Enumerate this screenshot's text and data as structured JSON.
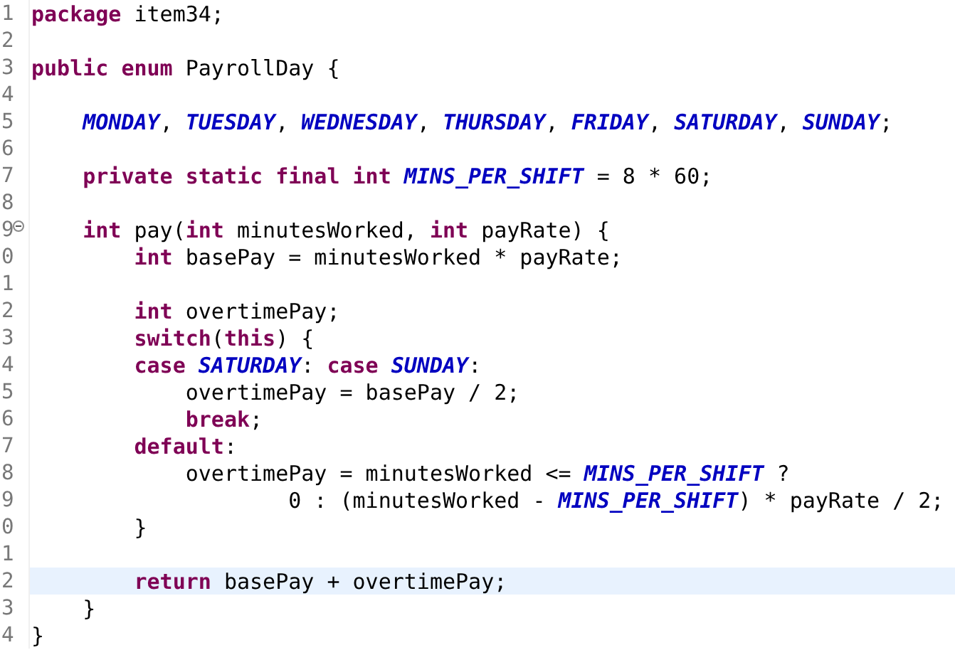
{
  "editor": {
    "lines": [
      {
        "number": "1",
        "current": false,
        "tokens": [
          {
            "kind": "keyword",
            "text": "package"
          },
          {
            "kind": "plain",
            "text": " item34;"
          }
        ]
      },
      {
        "number": "2",
        "current": false
      },
      {
        "number": "3",
        "current": false,
        "tokens": [
          {
            "kind": "keyword",
            "text": "public enum"
          },
          {
            "kind": "plain",
            "text": " PayrollDay {"
          }
        ]
      },
      {
        "number": "4",
        "current": false
      },
      {
        "number": "5",
        "current": false,
        "tokens": [
          {
            "kind": "constant",
            "text": "    MONDAY"
          },
          {
            "kind": "plain",
            "text": ", "
          },
          {
            "kind": "constant",
            "text": "TUESDAY"
          },
          {
            "kind": "plain",
            "text": ", "
          },
          {
            "kind": "constant",
            "text": "WEDNESDAY"
          },
          {
            "kind": "plain",
            "text": ", "
          },
          {
            "kind": "constant",
            "text": "THURSDAY"
          },
          {
            "kind": "plain",
            "text": ", "
          },
          {
            "kind": "constant",
            "text": "FRIDAY"
          },
          {
            "kind": "plain",
            "text": ", "
          },
          {
            "kind": "constant",
            "text": "SATURDAY"
          },
          {
            "kind": "plain",
            "text": ", "
          },
          {
            "kind": "constant",
            "text": "SUNDAY"
          },
          {
            "kind": "plain",
            "text": ";"
          }
        ]
      },
      {
        "number": "6",
        "current": false
      },
      {
        "number": "7",
        "current": false,
        "tokens": [
          {
            "kind": "keyword",
            "text": "    private static final int "
          },
          {
            "kind": "constant",
            "text": "MINS_PER_SHIFT"
          },
          {
            "kind": "plain",
            "text": " = 8 * 60;"
          }
        ]
      },
      {
        "number": "8",
        "current": false
      },
      {
        "number": "9",
        "current": false,
        "fold": {
          "expanded": true
        },
        "tokens": [
          {
            "kind": "keyword",
            "text": "    int"
          },
          {
            "kind": "plain",
            "text": " pay("
          },
          {
            "kind": "keyword",
            "text": "int"
          },
          {
            "kind": "plain",
            "text": " minutesWorked, "
          },
          {
            "kind": "keyword",
            "text": "int"
          },
          {
            "kind": "plain",
            "text": " payRate) {"
          }
        ]
      },
      {
        "number": "0",
        "current": false,
        "tokens": [
          {
            "kind": "keyword",
            "text": "        int"
          },
          {
            "kind": "plain",
            "text": " basePay = minutesWorked * payRate;"
          }
        ]
      },
      {
        "number": "1",
        "current": false
      },
      {
        "number": "2",
        "current": false,
        "tokens": [
          {
            "kind": "keyword",
            "text": "        int"
          },
          {
            "kind": "plain",
            "text": " overtimePay;"
          }
        ]
      },
      {
        "number": "3",
        "current": false,
        "tokens": [
          {
            "kind": "keyword",
            "text": "        switch"
          },
          {
            "kind": "plain",
            "text": "("
          },
          {
            "kind": "keyword",
            "text": "this"
          },
          {
            "kind": "plain",
            "text": ") {"
          }
        ]
      },
      {
        "number": "4",
        "current": false,
        "tokens": [
          {
            "kind": "keyword",
            "text": "        case "
          },
          {
            "kind": "constant",
            "text": "SATURDAY"
          },
          {
            "kind": "plain",
            "text": ": "
          },
          {
            "kind": "keyword",
            "text": "case "
          },
          {
            "kind": "constant",
            "text": "SUNDAY"
          },
          {
            "kind": "plain",
            "text": ":"
          }
        ]
      },
      {
        "number": "5",
        "current": false,
        "tokens": [
          {
            "kind": "plain",
            "text": "            overtimePay = basePay / 2;"
          }
        ]
      },
      {
        "number": "6",
        "current": false,
        "tokens": [
          {
            "kind": "keyword",
            "text": "            break"
          },
          {
            "kind": "plain",
            "text": ";"
          }
        ]
      },
      {
        "number": "7",
        "current": false,
        "tokens": [
          {
            "kind": "keyword",
            "text": "        default"
          },
          {
            "kind": "plain",
            "text": ":"
          }
        ]
      },
      {
        "number": "8",
        "current": false,
        "tokens": [
          {
            "kind": "plain",
            "text": "            overtimePay = minutesWorked <= "
          },
          {
            "kind": "constant",
            "text": "MINS_PER_SHIFT"
          },
          {
            "kind": "plain",
            "text": " ?"
          }
        ]
      },
      {
        "number": "9",
        "current": false,
        "tokens": [
          {
            "kind": "plain",
            "text": "                    0 : (minutesWorked - "
          },
          {
            "kind": "constant",
            "text": "MINS_PER_SHIFT"
          },
          {
            "kind": "plain",
            "text": ") * payRate / 2;"
          }
        ]
      },
      {
        "number": "0",
        "current": false,
        "tokens": [
          {
            "kind": "plain",
            "text": "        }"
          }
        ]
      },
      {
        "number": "1",
        "current": false
      },
      {
        "number": "2",
        "current": true,
        "tokens": [
          {
            "kind": "keyword",
            "text": "        return"
          },
          {
            "kind": "plain",
            "text": " basePay + overtimePay;"
          }
        ]
      },
      {
        "number": "3",
        "current": false,
        "tokens": [
          {
            "kind": "plain",
            "text": "    }"
          }
        ]
      },
      {
        "number": "4",
        "current": false,
        "tokens": [
          {
            "kind": "plain",
            "text": "}"
          }
        ]
      }
    ]
  }
}
